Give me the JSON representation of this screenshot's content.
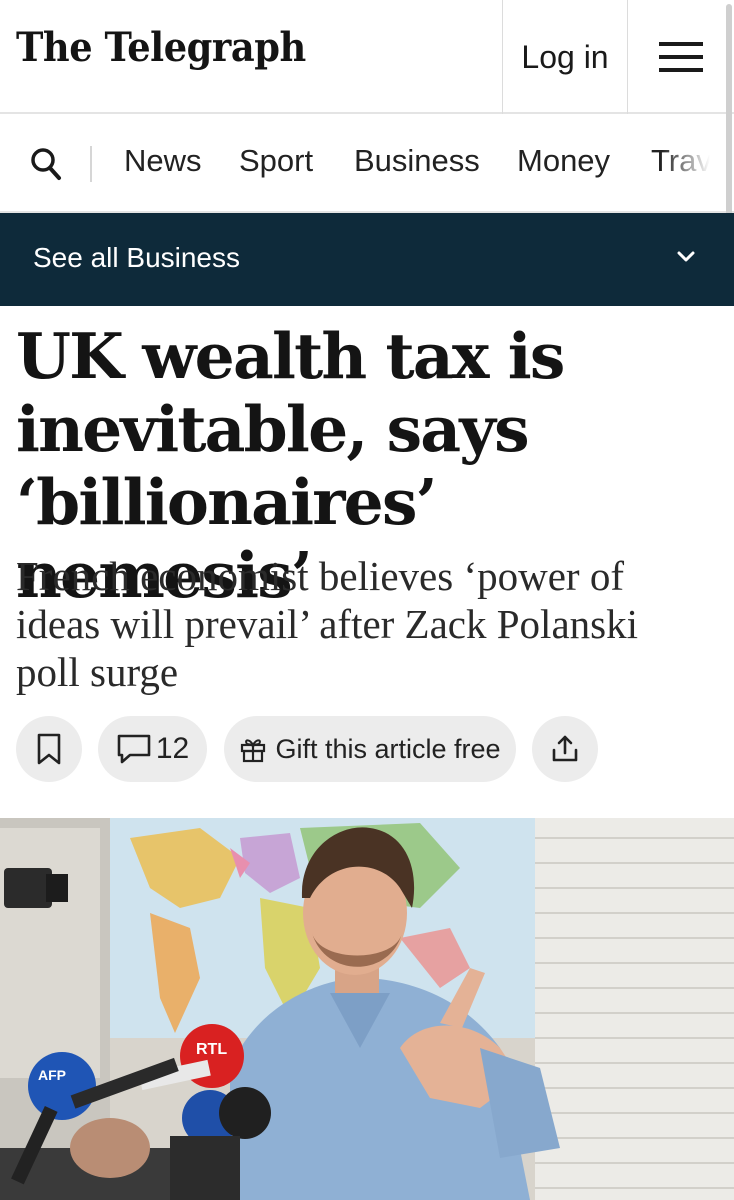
{
  "header": {
    "logo": "The Telegraph",
    "login_label": "Log in",
    "menu_icon": "hamburger-menu-icon"
  },
  "nav": {
    "search_icon": "search-icon",
    "items": [
      "News",
      "Sport",
      "Business",
      "Money",
      "Trav"
    ]
  },
  "section_bar": {
    "label": "See all Business",
    "icon": "chevron-down-icon",
    "background": "#0e2a3a"
  },
  "article": {
    "headline_lines": [
      "UK wealth tax is",
      "inevitable, says",
      "‘billionaires’ nemesis’"
    ],
    "standfirst_lines": [
      "French economist believes ‘power of",
      "ideas will prevail’ after Zack Polanski",
      "poll surge"
    ]
  },
  "actions": {
    "bookmark_icon": "bookmark-icon",
    "comment_icon": "comment-icon",
    "comment_count": "12",
    "gift_icon": "gift-icon",
    "gift_label": "Gift this article free",
    "share_icon": "share-icon"
  },
  "image": {
    "microphone_labels": [
      "AFP",
      "RTL"
    ]
  }
}
